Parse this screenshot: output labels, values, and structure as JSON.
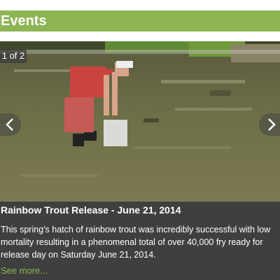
{
  "header": {
    "title": "Events"
  },
  "slideshow": {
    "counter": "1 of 2",
    "photo_subject": "person releasing rainbow trout fry into a stream",
    "prev_icon": "chevron-left-icon",
    "next_icon": "chevron-right-icon"
  },
  "event": {
    "title": "Rainbow Trout Release - June 21, 2014",
    "body": "This spring's hatch of rainbow trout was incredibly successful with low mortality resulting in a phenomenal total of over 40,000 fry ready for release day on Saturday June 21, 2014.",
    "link": "See more..."
  },
  "colors": {
    "accent": "#8db554",
    "caption_bg": "#3f3f3f",
    "header_text": "#ffffff"
  }
}
